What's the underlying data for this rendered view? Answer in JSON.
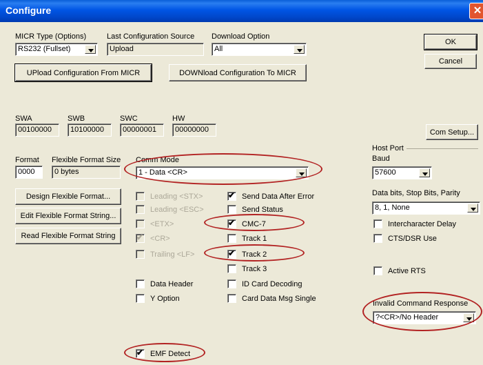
{
  "window": {
    "title": "Configure"
  },
  "micr_type": {
    "label": "MICR Type (Options)",
    "value": "RS232 (Fullset)"
  },
  "last_config": {
    "label": "Last Configuration Source",
    "value": "Upload"
  },
  "download_option": {
    "label": "Download Option",
    "value": "All"
  },
  "buttons": {
    "upload": "UPload Configuration From MICR",
    "download": "DOWNload Configuration To MICR",
    "ok": "OK",
    "cancel": "Cancel",
    "com_setup": "Com Setup...",
    "design": "Design Flexible Format...",
    "edit": "Edit Flexible Format String...",
    "read": "Read Flexible Format String"
  },
  "switches": {
    "swa": {
      "label": "SWA",
      "value": "00100000"
    },
    "swb": {
      "label": "SWB",
      "value": "10100000"
    },
    "swc": {
      "label": "SWC",
      "value": "00000001"
    },
    "hw": {
      "label": "HW",
      "value": "00000000"
    }
  },
  "format": {
    "label": "Format",
    "value": "0000"
  },
  "flex_size": {
    "label": "Flexible Format Size",
    "value": "0 bytes"
  },
  "comm_mode": {
    "label": "Comm Mode",
    "value": "1 - Data <CR>"
  },
  "left_checks": [
    {
      "label": "Leading <STX>",
      "checked": false,
      "disabled": true
    },
    {
      "label": "Leading <ESC>",
      "checked": false,
      "disabled": true
    },
    {
      "label": "<ETX>",
      "checked": false,
      "disabled": true
    },
    {
      "label": "<CR>",
      "checked": true,
      "disabled": true
    },
    {
      "label": "Trailing <LF>",
      "checked": false,
      "disabled": true
    }
  ],
  "mid_checks": [
    {
      "label": "Send Data After Error",
      "checked": true
    },
    {
      "label": "Send Status",
      "checked": false
    },
    {
      "label": "CMC-7",
      "checked": true
    },
    {
      "label": "Track 1",
      "checked": false
    },
    {
      "label": "Track 2",
      "checked": true
    },
    {
      "label": "Track 3",
      "checked": false
    },
    {
      "label": "ID Card Decoding",
      "checked": false
    },
    {
      "label": "Card Data Msg Single",
      "checked": false
    }
  ],
  "lower_checks": [
    {
      "label": "Data Header",
      "checked": false
    },
    {
      "label": "Y Option",
      "checked": false
    }
  ],
  "emf_detect": {
    "label": "EMF Detect",
    "checked": true
  },
  "host_port": {
    "group_label": "Host Port",
    "baud_label": "Baud",
    "baud_value": "57600",
    "bits_label": "Data bits, Stop Bits, Parity",
    "bits_value": "8, 1, None",
    "intercharacter_delay": {
      "label": "Intercharacter Delay",
      "checked": false
    },
    "cts_dsr": {
      "label": "CTS/DSR Use",
      "checked": false
    },
    "active_rts": {
      "label": "Active RTS",
      "checked": false
    }
  },
  "invalid_cmd": {
    "label": "Invalid Command Response",
    "value": "?<CR>/No Header"
  },
  "check_mark": "✔",
  "colors": {
    "titlebar": "#0055e5",
    "dialog": "#ece9d8",
    "highlight_oval": "#b22222"
  }
}
